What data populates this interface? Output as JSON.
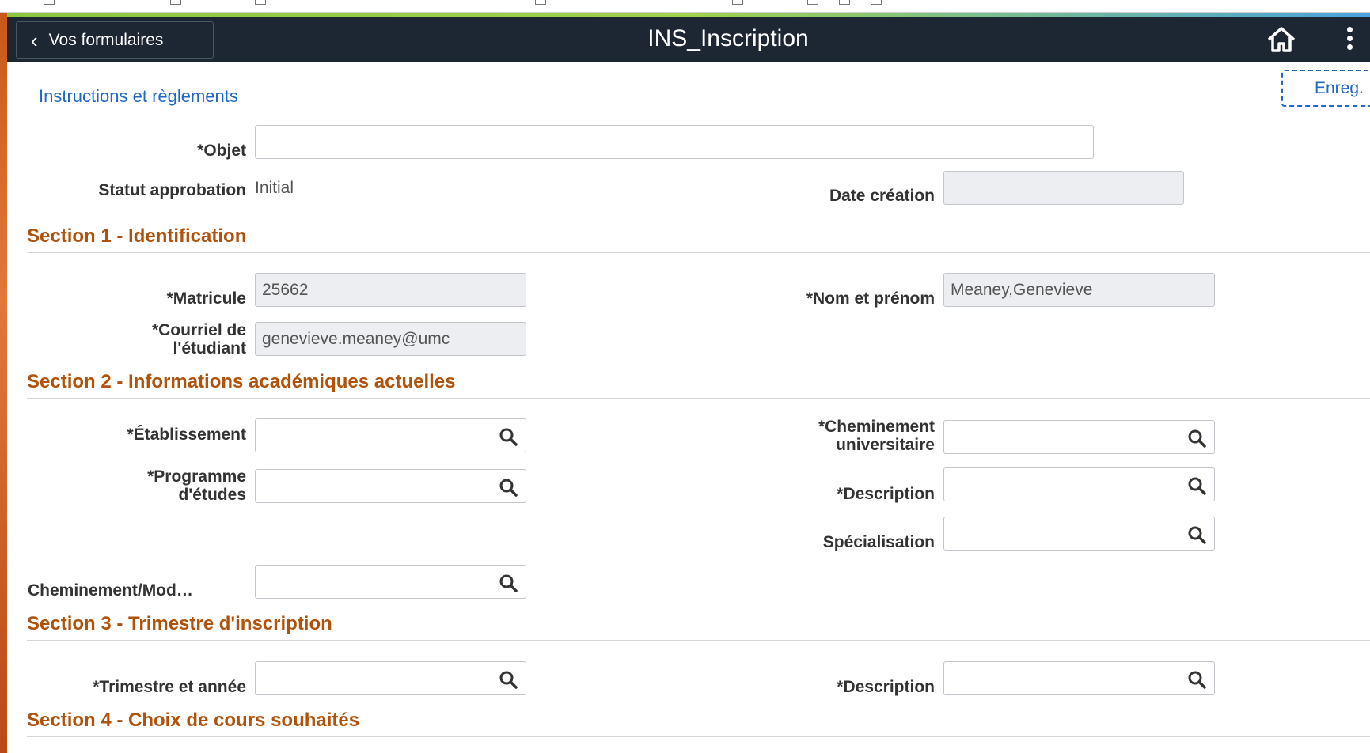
{
  "header": {
    "back_label": "Vos formulaires",
    "title": "INS_Inscription",
    "home_icon": "home-icon",
    "menu_icon": "kebab-menu-icon"
  },
  "toolbar": {
    "instructions_link": "Instructions et règlements",
    "save_label": "Enreg."
  },
  "form": {
    "objet_label": "*Objet",
    "objet_value": "",
    "statut_label": "Statut approbation",
    "statut_value": "Initial",
    "date_label": "Date création",
    "date_value": ""
  },
  "section1": {
    "title": "Section 1 - Identification",
    "matricule_label": "*Matricule",
    "matricule_value": "25662",
    "nom_label": "*Nom et prénom",
    "nom_value": "Meaney,Genevieve",
    "courriel_label_1": "*Courriel de",
    "courriel_label_2": "l'étudiant",
    "courriel_value": "genevieve.meaney@umc"
  },
  "section2": {
    "title": "Section 2 - Informations académiques actuelles",
    "etablissement_label": "*Établissement",
    "cheminement_label_1": "*Cheminement",
    "cheminement_label_2": "universitaire",
    "programme_label_1": "*Programme",
    "programme_label_2": "d'études",
    "description_label": "*Description",
    "specialisation_label": "Spécialisation",
    "cheminement_mod_label": "Cheminement/Mod…"
  },
  "section3": {
    "title": "Section 3 - Trimestre d'inscription",
    "trimestre_label": "*Trimestre et année",
    "description_label": "*Description"
  },
  "section4": {
    "title": "Section 4 - Choix de cours souhaités"
  },
  "colors": {
    "header_bg": "#1d2633",
    "section_title": "#b0520c",
    "link": "#2068c4"
  }
}
